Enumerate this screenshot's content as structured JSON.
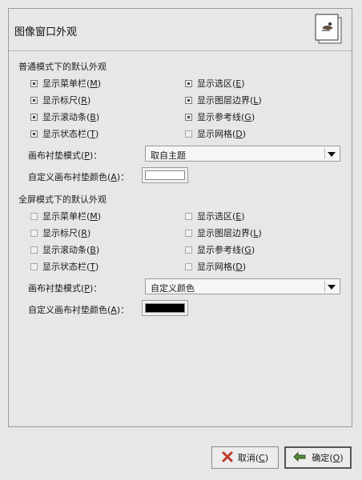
{
  "header": {
    "title": "图像窗口外观",
    "icon": "image-window-icon"
  },
  "normal": {
    "title": "普通模式下的默认外观",
    "left": [
      {
        "label": "显示菜单栏",
        "key": "M",
        "checked": true
      },
      {
        "label": "显示标尺",
        "key": "R",
        "checked": true
      },
      {
        "label": "显示滚动条",
        "key": "B",
        "checked": true
      },
      {
        "label": "显示状态栏",
        "key": "T",
        "checked": true
      }
    ],
    "right": [
      {
        "label": "显示选区",
        "key": "E",
        "checked": true
      },
      {
        "label": "显示图层边界",
        "key": "L",
        "checked": true
      },
      {
        "label": "显示参考线",
        "key": "G",
        "checked": true
      },
      {
        "label": "显示网格",
        "key": "D",
        "checked": false
      }
    ],
    "padding_mode_label": "画布衬垫模式",
    "padding_mode_key": "P",
    "padding_mode_value": "取自主题",
    "padding_color_label": "自定义画布衬垫颜色",
    "padding_color_key": "A",
    "padding_color": "#ffffff"
  },
  "fullscreen": {
    "title": "全屏模式下的默认外观",
    "left": [
      {
        "label": "显示菜单栏",
        "key": "M",
        "checked": false
      },
      {
        "label": "显示标尺",
        "key": "R",
        "checked": false
      },
      {
        "label": "显示滚动条",
        "key": "B",
        "checked": false
      },
      {
        "label": "显示状态栏",
        "key": "T",
        "checked": false
      }
    ],
    "right": [
      {
        "label": "显示选区",
        "key": "E",
        "checked": false
      },
      {
        "label": "显示图层边界",
        "key": "L",
        "checked": false
      },
      {
        "label": "显示参考线",
        "key": "G",
        "checked": false
      },
      {
        "label": "显示网格",
        "key": "D",
        "checked": false
      }
    ],
    "padding_mode_label": "画布衬垫模式",
    "padding_mode_key": "P",
    "padding_mode_value": "自定义颜色",
    "padding_color_label": "自定义画布衬垫颜色",
    "padding_color_key": "A",
    "padding_color": "#000000"
  },
  "buttons": {
    "cancel": {
      "label": "取消",
      "key": "C",
      "icon": "cancel-x-icon"
    },
    "ok": {
      "label": "确定",
      "key": "O",
      "icon": "ok-arrow-icon"
    }
  },
  "colors": {
    "cancel_icon": "#c0392b",
    "ok_icon": "#5a8a3a"
  }
}
